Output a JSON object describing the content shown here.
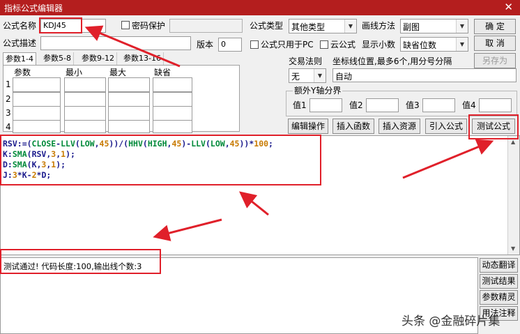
{
  "window": {
    "title": "指标公式编辑器",
    "close_glyph": "✕"
  },
  "form": {
    "name_label": "公式名称",
    "name_value": "KDJ45",
    "password_label": "密码保护",
    "desc_label": "公式描述",
    "desc_value": "",
    "version_label": "版本",
    "version_value": "0",
    "type_label": "公式类型",
    "type_value": "其他类型",
    "draw_label": "画线方法",
    "draw_value": "副图",
    "pc_only_label": "公式只用于PC",
    "cloud_label": "云公式",
    "decimals_label": "显示小数",
    "decimals_value": "缺省位数"
  },
  "buttons": {
    "ok": "确  定",
    "cancel": "取  消",
    "save_as": "另存为",
    "edit": "编辑操作",
    "insert_func": "插入函数",
    "insert_res": "插入资源",
    "import": "引入公式",
    "test": "测试公式"
  },
  "tabs": [
    "参数1-4",
    "参数5-8",
    "参数9-12",
    "参数13-16"
  ],
  "params": {
    "headers": [
      "参数",
      "最小",
      "最大",
      "缺省"
    ],
    "rows": [
      "1",
      "2",
      "3",
      "4"
    ]
  },
  "trade": {
    "label": "交易法则",
    "value": "无",
    "coord_label": "坐标线位置,最多6个,用分号分隔",
    "coord_value": "自动"
  },
  "yaxis": {
    "label": "额外Y轴分界",
    "value_labels": [
      "值1",
      "值2",
      "值3",
      "值4"
    ]
  },
  "code_lines": [
    [
      {
        "t": "RSV:=(",
        "c": "b"
      },
      {
        "t": "CLOSE",
        "c": "g"
      },
      {
        "t": "-",
        "c": "b"
      },
      {
        "t": "LLV",
        "c": "g"
      },
      {
        "t": "(",
        "c": "b"
      },
      {
        "t": "LOW",
        "c": "g"
      },
      {
        "t": ",",
        "c": "b"
      },
      {
        "t": "45",
        "c": "o"
      },
      {
        "t": "))/(",
        "c": "b"
      },
      {
        "t": "HHV",
        "c": "g"
      },
      {
        "t": "(",
        "c": "b"
      },
      {
        "t": "HIGH",
        "c": "g"
      },
      {
        "t": ",",
        "c": "b"
      },
      {
        "t": "45",
        "c": "o"
      },
      {
        "t": ")-",
        "c": "b"
      },
      {
        "t": "LLV",
        "c": "g"
      },
      {
        "t": "(",
        "c": "b"
      },
      {
        "t": "LOW",
        "c": "g"
      },
      {
        "t": ",",
        "c": "b"
      },
      {
        "t": "45",
        "c": "o"
      },
      {
        "t": "))*",
        "c": "b"
      },
      {
        "t": "100",
        "c": "o"
      },
      {
        "t": ";",
        "c": "b"
      }
    ],
    [
      {
        "t": "K:",
        "c": "b"
      },
      {
        "t": "SMA",
        "c": "g"
      },
      {
        "t": "(RSV,",
        "c": "b"
      },
      {
        "t": "3",
        "c": "o"
      },
      {
        "t": ",",
        "c": "b"
      },
      {
        "t": "1",
        "c": "o"
      },
      {
        "t": ");",
        "c": "b"
      }
    ],
    [
      {
        "t": "D:",
        "c": "b"
      },
      {
        "t": "SMA",
        "c": "g"
      },
      {
        "t": "(K,",
        "c": "b"
      },
      {
        "t": "3",
        "c": "o"
      },
      {
        "t": ",",
        "c": "b"
      },
      {
        "t": "1",
        "c": "o"
      },
      {
        "t": ");",
        "c": "b"
      }
    ],
    [
      {
        "t": "J:",
        "c": "b"
      },
      {
        "t": "3",
        "c": "o"
      },
      {
        "t": "*K-",
        "c": "b"
      },
      {
        "t": "2",
        "c": "o"
      },
      {
        "t": "*D;",
        "c": "b"
      }
    ]
  ],
  "code_colors": {
    "b": "#1a1a8c",
    "g": "#008a3a",
    "o": "#c87a00"
  },
  "status": {
    "text": "测试通过! 代码长度:100,输出线个数:3"
  },
  "side_buttons": [
    "动态翻译",
    "测试结果",
    "参数精灵",
    "用法注释"
  ],
  "watermark": "头条 @金融碎片集",
  "colors": {
    "title_bar": "#b41e1e",
    "annotation_red": "#e0202a"
  }
}
